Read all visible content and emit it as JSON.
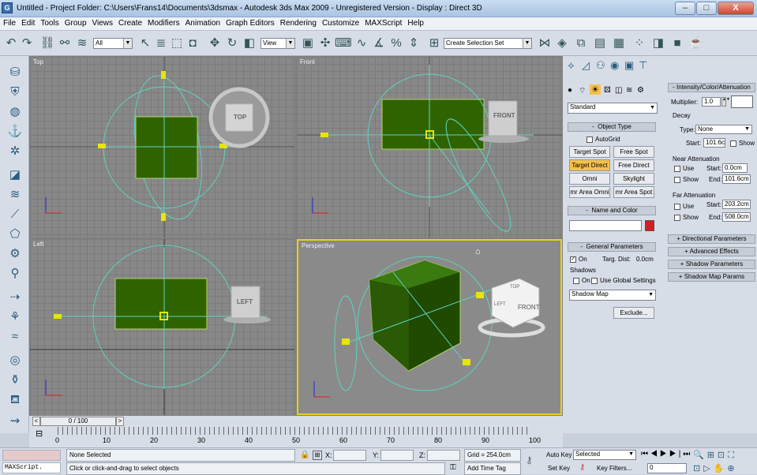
{
  "window": {
    "title": "Untitled     - Project Folder: C:\\Users\\Frans14\\Documents\\3dsmax      - Autodesk 3ds Max  2009  - Unregistered Version      - Display : Direct 3D",
    "icon_name": "max-app-icon",
    "controls": {
      "minimize": "–",
      "maximize": "□",
      "close": "X"
    }
  },
  "menubar": [
    "File",
    "Edit",
    "Tools",
    "Group",
    "Views",
    "Create",
    "Modifiers",
    "Animation",
    "Graph Editors",
    "Rendering",
    "Customize",
    "MAXScript",
    "Help"
  ],
  "toolbar": {
    "filter_value": "All",
    "ref_coord_value": "View",
    "named_selection_placeholder": "Create Selection Set",
    "icons": [
      "undo-icon",
      "redo-icon",
      "link-icon",
      "unlink-icon",
      "bind-space-warp-icon",
      "select-icon",
      "select-by-name-icon",
      "rect-region-icon",
      "window-crossing-icon",
      "move-icon",
      "rotate-icon",
      "scale-icon",
      "pivot-icon",
      "manipulate-icon",
      "keyboard-shortcut-icon",
      "snap-3d-icon",
      "angle-snap-icon",
      "percent-snap-icon",
      "spinner-snap-icon",
      "edit-named-sets-icon",
      "mirror-icon",
      "align-icon",
      "layer-manager-icon",
      "curve-editor-icon",
      "schematic-view-icon",
      "material-editor-icon",
      "render-setup-icon",
      "rendered-frame-icon",
      "render-icon"
    ]
  },
  "viewports": {
    "top": {
      "label": "Top",
      "cube_label": "TOP"
    },
    "front": {
      "label": "Front",
      "cube_label": "FRONT"
    },
    "left": {
      "label": "Left",
      "cube_label": "LEFT"
    },
    "perspective": {
      "label": "Perspective",
      "cube_top": "TOP",
      "cube_front": "FRONT",
      "cube_left": "LEFT"
    }
  },
  "command_panel": {
    "category_value": "Standard",
    "object_type": {
      "title": "Object Type",
      "autogrid": "AutoGrid",
      "buttons": [
        "Target Spot",
        "Free Spot",
        "Target Direct",
        "Free Direct",
        "Omni",
        "Skylight",
        "mr Area Omni",
        "mr Area Spot"
      ],
      "active_button": "Target Direct"
    },
    "name_color": {
      "title": "Name and Color",
      "name_value": "",
      "swatch_color": "#cc2222"
    },
    "general": {
      "title": "General Parameters",
      "on_label": "On",
      "targ_dist_label": "Targ. Dist:",
      "targ_dist_value": "0.0cm",
      "shadows_group": "Shadows",
      "shadows_on": "On",
      "use_global": "Use Global Settings",
      "shadow_type": "Shadow Map",
      "exclude": "Exclude..."
    }
  },
  "side_panel": {
    "intensity_title": "Intensity/Color/Attenuation",
    "multiplier_label": "Multiplier:",
    "multiplier_value": "1.0",
    "decay_group": "Decay",
    "type_label": "Type:",
    "type_value": "None",
    "start_label": "Start:",
    "start_value": "101.6c",
    "show_label": "Show",
    "near_group": "Near Attenuation",
    "near_use": "Use",
    "near_start_value": "0.0cm",
    "near_show": "Show",
    "end_label": "End:",
    "near_end_value": "101.6cm",
    "far_group": "Far Attenuation",
    "far_use": "Use",
    "far_start_value": "203.2cm",
    "far_show": "Show",
    "far_end_value": "508.0cm",
    "rollouts": [
      "Directional Parameters",
      "Advanced Effects",
      "Shadow Parameters",
      "Shadow Map Params"
    ]
  },
  "timeline": {
    "slider_value": "0 / 100",
    "ticks": [
      "0",
      "10",
      "20",
      "30",
      "40",
      "50",
      "60",
      "70",
      "80",
      "90",
      "100"
    ]
  },
  "statusbar": {
    "maxscript_label": "MAXScript.",
    "selection_status": "None Selected",
    "prompt": "Click or click-and-drag to select objects",
    "x_label": "X:",
    "y_label": "Y:",
    "z_label": "Z:",
    "grid": "Grid = 254.0cm",
    "add_time_tag": "Add Time Tag",
    "auto_key": "Auto Key",
    "set_key": "Set Key",
    "selected_value": "Selected",
    "key_filters": "Key Filters...",
    "frame_value": "0"
  }
}
